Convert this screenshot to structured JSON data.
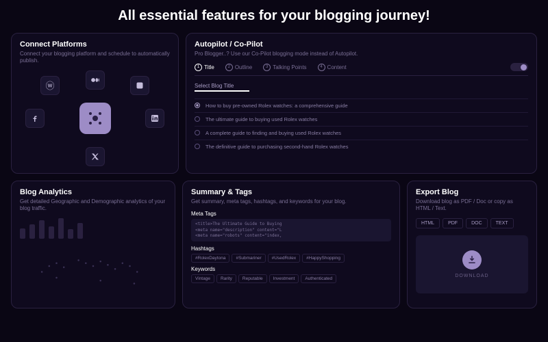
{
  "heading": "All essential features for your blogging journey!",
  "platforms": {
    "title": "Connect Platforms",
    "subtitle": "Connect your blogging platform and schedule to automatically publish.",
    "icons": [
      "wordpress",
      "medium",
      "blogger",
      "facebook",
      "linkedin",
      "x"
    ]
  },
  "autopilot": {
    "title": "Autopilot / Co-Pilot",
    "subtitle": "Pro Blogger..? Use our Co-Pilot blogging mode instead of Autopilot.",
    "tabs": [
      {
        "num": "1",
        "label": "Title"
      },
      {
        "num": "2",
        "label": "Outline"
      },
      {
        "num": "3",
        "label": "Talking Points"
      },
      {
        "num": "4",
        "label": "Content"
      }
    ],
    "section_label": "Select Blog Title",
    "options": [
      "How to buy pre-owned Rolex watches: a comprehensive guide",
      "The ultimate guide to buying used Rolex watches",
      "A complete guide to finding and buying used Rolex watches",
      "The definitive guide to purchasing second-hand Rolex watches"
    ]
  },
  "analytics": {
    "title": "Blog Analytics",
    "subtitle": "Get detailed Geographic and Demographic analytics of your blog traffic."
  },
  "summary": {
    "title": "Summary & Tags",
    "subtitle": "Get summary, meta tags, hashtags, and keywords for your blog.",
    "meta_label": "Meta Tags",
    "meta_code": "<title>The Ultimate Guide to Buying\n<meta name=\"description\" content=\"L\n<meta name=\"robots\" content=\"index,",
    "hashtags_label": "Hashtags",
    "hashtags": [
      "#RolexDaytona",
      "#Submariner",
      "#UsedRolex",
      "#HappyShopping"
    ],
    "keywords_label": "Keywords",
    "keywords": [
      "Vintage",
      "Rarity",
      "Reputable",
      "Investment",
      "Authenticated"
    ]
  },
  "export": {
    "title": "Export Blog",
    "subtitle": "Download blog as PDF / Doc or copy as HTML / Text.",
    "buttons": [
      "HTML",
      "PDF",
      "DOC",
      "TEXT"
    ],
    "download_label": "DOWNLOAD"
  }
}
